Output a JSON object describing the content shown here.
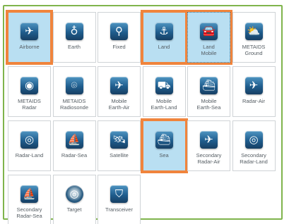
{
  "tiles": [
    {
      "label": "Airborne",
      "icon": "airplane-icon",
      "glyph": "✈",
      "selected": true,
      "highlighted": true
    },
    {
      "label": "Earth",
      "icon": "satellite-dish-icon",
      "glyph": "♁",
      "selected": false,
      "highlighted": false
    },
    {
      "label": "Fixed",
      "icon": "antenna-tower-icon",
      "glyph": "⚲",
      "selected": false,
      "highlighted": false
    },
    {
      "label": "Land",
      "icon": "antenna-land-icon",
      "glyph": "⚓",
      "selected": true,
      "highlighted": true
    },
    {
      "label": "Land\nMobile",
      "icon": "car-icon",
      "glyph": "🚘",
      "selected": true,
      "highlighted": true,
      "dotted": true
    },
    {
      "label": "METAIDS\nGround",
      "icon": "weather-station-icon",
      "glyph": "⛅",
      "selected": false,
      "highlighted": false
    },
    {
      "label": "METAIDS\nRadar",
      "icon": "radar-dish-icon",
      "glyph": "◉",
      "selected": false,
      "highlighted": false
    },
    {
      "label": "METAIDS\nRadiosonde",
      "icon": "weather-balloon-icon",
      "glyph": "⌾",
      "selected": false,
      "highlighted": false
    },
    {
      "label": "Mobile\nEarth-Air",
      "icon": "airplane-earth-icon",
      "glyph": "✈",
      "selected": false,
      "highlighted": false
    },
    {
      "label": "Mobile\nEarth-Land",
      "icon": "vehicle-earth-icon",
      "glyph": "⛟",
      "selected": false,
      "highlighted": false
    },
    {
      "label": "Mobile\nEarth-Sea",
      "icon": "ship-earth-icon",
      "glyph": "⛴",
      "selected": false,
      "highlighted": false
    },
    {
      "label": "Radar-Air",
      "icon": "radar-airplane-icon",
      "glyph": "✈",
      "selected": false,
      "highlighted": false
    },
    {
      "label": "Radar-Land",
      "icon": "radar-land-icon",
      "glyph": "◎",
      "selected": false,
      "highlighted": false
    },
    {
      "label": "Radar-Sea",
      "icon": "radar-sea-icon",
      "glyph": "⛵",
      "selected": false,
      "highlighted": false
    },
    {
      "label": "Satellite",
      "icon": "satellite-icon",
      "glyph": "🛰",
      "selected": false,
      "highlighted": false
    },
    {
      "label": "Sea",
      "icon": "ship-icon",
      "glyph": "⛴",
      "selected": true,
      "highlighted": true
    },
    {
      "label": "Secondary\nRadar-Air",
      "icon": "secondary-radar-air-icon",
      "glyph": "✈",
      "selected": false,
      "highlighted": false
    },
    {
      "label": "Secondary\nRadar-Land",
      "icon": "secondary-radar-land-icon",
      "glyph": "◎",
      "selected": false,
      "highlighted": false
    },
    {
      "label": "Secondary\nRadar-Sea",
      "icon": "secondary-radar-sea-icon",
      "glyph": "⛵",
      "selected": false,
      "highlighted": false
    },
    {
      "label": "Target",
      "icon": "target-icon",
      "glyph": "◎",
      "selected": false,
      "highlighted": false,
      "ring": true
    },
    {
      "label": "Transceiver",
      "icon": "transceiver-icon",
      "glyph": "⛉",
      "selected": false,
      "highlighted": false
    }
  ],
  "colors": {
    "selected_fill": "#b9dff2",
    "highlight_outline": "#f0843c",
    "frame_border": "#7fb44c",
    "icon_blue": "#1f5d8d"
  }
}
